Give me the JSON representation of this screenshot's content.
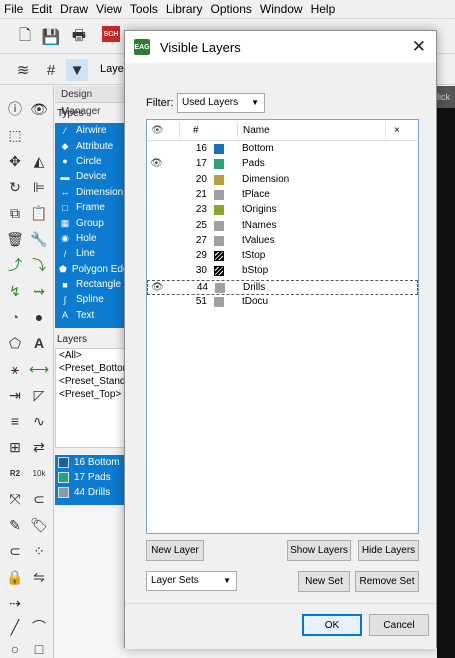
{
  "menu": [
    "File",
    "Edit",
    "Draw",
    "View",
    "Tools",
    "Library",
    "Options",
    "Window",
    "Help"
  ],
  "toolbar2": {
    "layers_label": "Layers"
  },
  "design_manager": {
    "title": "Design Manager",
    "types_label": "Types",
    "types": [
      {
        "label": "Airwire",
        "icon": "airwire-icon",
        "glyph": "⁄"
      },
      {
        "label": "Attribute",
        "icon": "attribute-icon",
        "glyph": "◆"
      },
      {
        "label": "Circle",
        "icon": "circle-icon",
        "glyph": "●"
      },
      {
        "label": "Device",
        "icon": "device-icon",
        "glyph": "▬"
      },
      {
        "label": "Dimension",
        "icon": "dimension-icon",
        "glyph": "↔"
      },
      {
        "label": "Frame",
        "icon": "frame-icon",
        "glyph": "□"
      },
      {
        "label": "Group",
        "icon": "group-icon",
        "glyph": "▦"
      },
      {
        "label": "Hole",
        "icon": "hole-icon",
        "glyph": "◉"
      },
      {
        "label": "Line",
        "icon": "line-icon",
        "glyph": "/"
      },
      {
        "label": "Polygon Edge",
        "icon": "polygon-icon",
        "glyph": "⬟"
      },
      {
        "label": "Rectangle",
        "icon": "rectangle-icon",
        "glyph": "■"
      },
      {
        "label": "Spline",
        "icon": "spline-icon",
        "glyph": "∫"
      },
      {
        "label": "Text",
        "icon": "text-icon",
        "glyph": "A"
      }
    ],
    "layers_label": "Layers",
    "layer_list": [
      "<All>",
      "<Preset_Bottom>",
      "<Preset_Standard>",
      "<Preset_Top>"
    ],
    "selected_layers": [
      {
        "label": "16 Bottom",
        "color": "#1a5fa8"
      },
      {
        "label": "17 Pads",
        "color": "#1aa87e"
      },
      {
        "label": "44 Drills",
        "color": "#8a9aaa"
      }
    ]
  },
  "canvas": {
    "tab_text": "lick"
  },
  "dialog": {
    "title": "Visible Layers",
    "logo_text": "EAG",
    "filter_label": "Filter:",
    "filter_value": "Used Layers",
    "columns": {
      "eye": "👁",
      "num": "#",
      "name": "Name",
      "close": "×"
    },
    "rows": [
      {
        "visible": false,
        "num": "16",
        "name": "Bottom",
        "color": "#1a6fb8",
        "pattern": "solid"
      },
      {
        "visible": true,
        "num": "17",
        "name": "Pads",
        "color": "#2ea07a",
        "pattern": "solid"
      },
      {
        "visible": false,
        "num": "20",
        "name": "Dimension",
        "color": "#b8a13a",
        "pattern": "solid"
      },
      {
        "visible": false,
        "num": "21",
        "name": "tPlace",
        "color": "#a0a0a0",
        "pattern": "solid"
      },
      {
        "visible": false,
        "num": "23",
        "name": "tOrigins",
        "color": "#8aa82a",
        "pattern": "solid"
      },
      {
        "visible": false,
        "num": "25",
        "name": "tNames",
        "color": "#a0a0a0",
        "pattern": "solid"
      },
      {
        "visible": false,
        "num": "27",
        "name": "tValues",
        "color": "#a0a0a0",
        "pattern": "solid"
      },
      {
        "visible": false,
        "num": "29",
        "name": "tStop",
        "color": "#111111",
        "pattern": "hatch"
      },
      {
        "visible": false,
        "num": "30",
        "name": "bStop",
        "color": "#111111",
        "pattern": "hatch"
      },
      {
        "visible": true,
        "num": "44",
        "name": "Drills",
        "color": "#a0a0a0",
        "pattern": "solid",
        "selected": true
      },
      {
        "visible": false,
        "num": "51",
        "name": "tDocu",
        "color": "#a0a0a0",
        "pattern": "solid"
      }
    ],
    "buttons": {
      "new_layer": "New Layer",
      "show_layers": "Show Layers",
      "hide_layers": "Hide Layers",
      "layer_sets": "Layer Sets",
      "new_set": "New Set",
      "remove_set": "Remove Set",
      "ok": "OK",
      "cancel": "Cancel"
    }
  }
}
